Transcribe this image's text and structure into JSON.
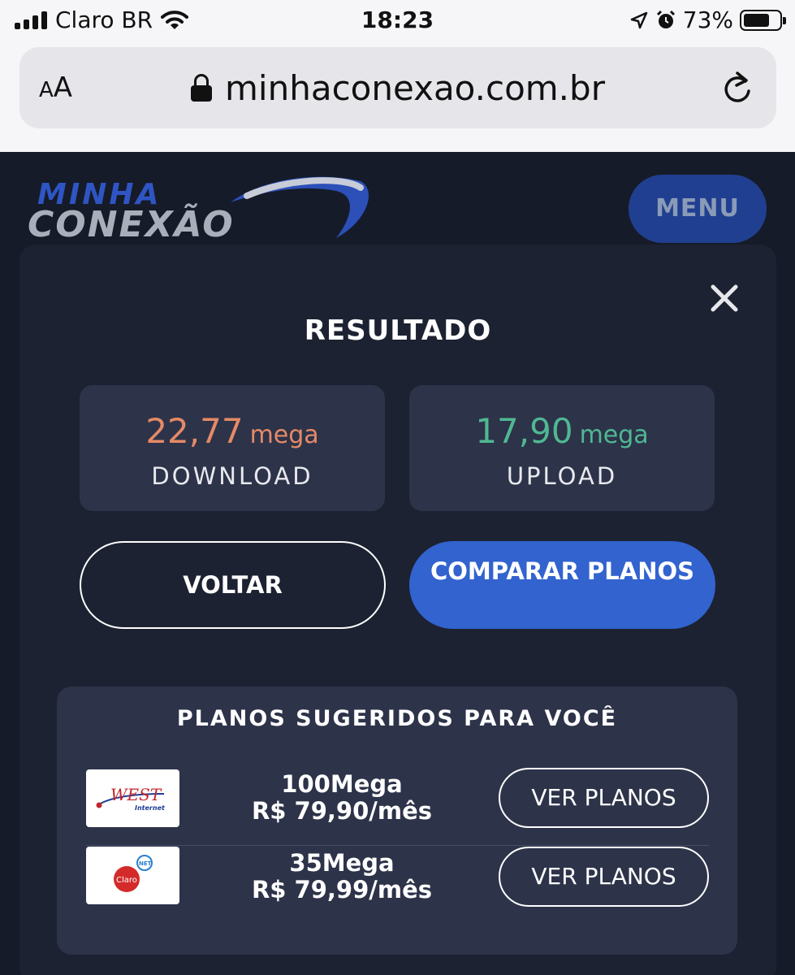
{
  "statusbar": {
    "carrier": "Claro BR",
    "time": "18:23",
    "battery": "73%",
    "battery_level": 0.73
  },
  "browser": {
    "text_size_label": "AA",
    "url": "minhaconexao.com.br"
  },
  "header": {
    "logo_top": "MINHA",
    "logo_bottom": "CONEXÃO",
    "menu_label": "MENU"
  },
  "result": {
    "title": "RESULTADO",
    "download": {
      "value": "22,77",
      "unit": "mega",
      "label": "DOWNLOAD"
    },
    "upload": {
      "value": "17,90",
      "unit": "mega",
      "label": "UPLOAD"
    },
    "back_label": "VOLTAR",
    "compare_label": "COMPARAR PLANOS"
  },
  "plans": {
    "title": "PLANOS SUGERIDOS PARA VOCÊ",
    "items": [
      {
        "logo_text": "WEST",
        "logo_sub": "Internet",
        "speed": "100Mega",
        "price": "R$ 79,90/mês",
        "button": "VER PLANOS"
      },
      {
        "logo_text": "Claro",
        "logo_sub": "NET",
        "speed": "35Mega",
        "price": "R$ 79,99/mês",
        "button": "VER PLANOS"
      }
    ]
  },
  "colors": {
    "download": "#e58a66",
    "upload": "#4fb892",
    "accent": "#3263cf",
    "menu": "#213f90"
  }
}
